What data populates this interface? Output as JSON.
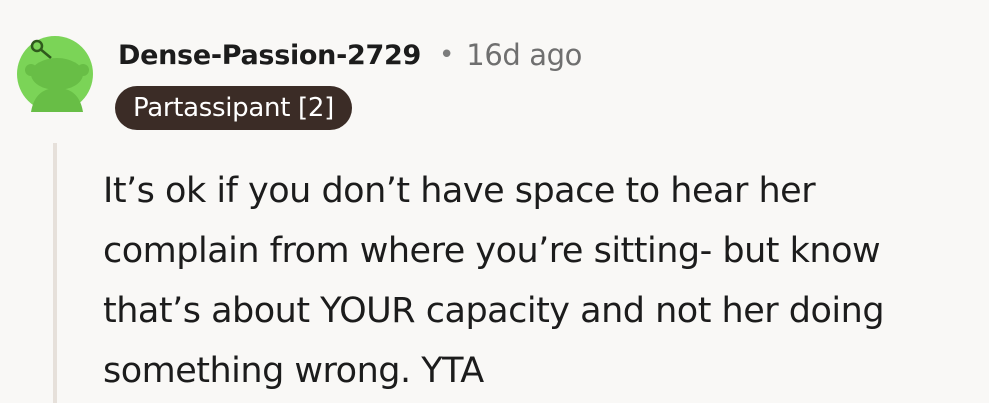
{
  "comment": {
    "username": "Dense-Passion-2729",
    "separator": "•",
    "time_ago": "16d ago",
    "flair": "Partassipant [2]",
    "body": "It’s ok if you don’t have space to hear her complain from where you’re sitting- but know that’s about YOUR capacity and not her doing something wrong. YTA",
    "avatar_icon": "snoo-avatar-icon",
    "colors": {
      "avatar_green": "#7bd457",
      "flair_bg": "#3b2c26",
      "background": "#f9f8f6",
      "thread_line": "#e6e0da"
    }
  }
}
